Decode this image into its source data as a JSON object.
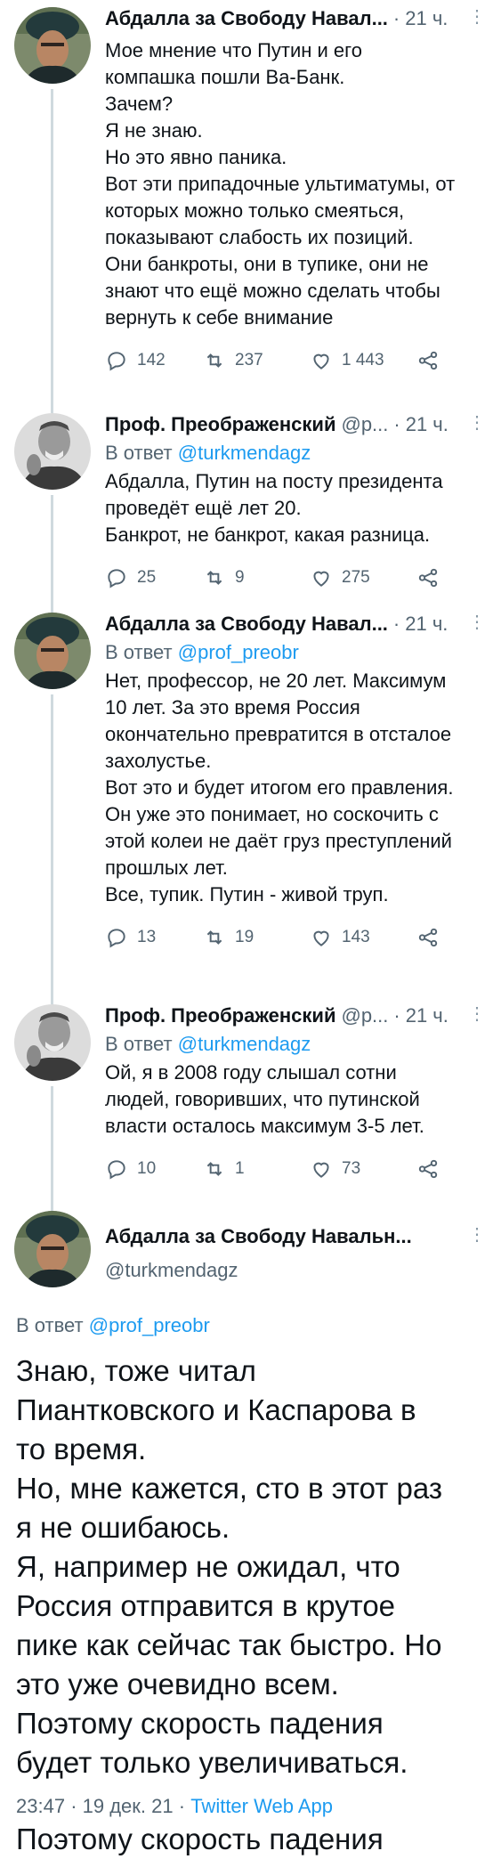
{
  "tweets": [
    {
      "name": "Абдалла за Свободу Навал...",
      "handle": "",
      "time": "21 ч.",
      "reply_to_prefix": "",
      "reply_to_handle": "",
      "lines": [
        "Мое мнение что Путин и его",
        "компашка пошли Ва-Банк.",
        "Зачем?",
        "Я не знаю.",
        "Но это явно паника.",
        "Вот эти припадочные ультиматумы, от",
        "которых можно только смеяться,",
        "показывают слабость их позиций.",
        "Они банкроты, они в тупике, они не",
        "знают что ещё можно сделать чтобы",
        "вернуть к себе внимание"
      ],
      "replies": "142",
      "retweets": "237",
      "likes": "1 443",
      "avatar": "turban-avatar"
    },
    {
      "name": "Проф. Преображенский",
      "handle": "@p...",
      "time": "21 ч.",
      "reply_to_prefix": "В ответ",
      "reply_to_handle": "@turkmendagz",
      "lines": [
        "Абдалла, Путин на посту президента",
        "проведёт ещё лет 20.",
        "Банкрот, не банкрот, какая разница."
      ],
      "replies": "25",
      "retweets": "9",
      "likes": "275",
      "avatar": "professor-avatar"
    },
    {
      "name": "Абдалла за Свободу Навал...",
      "handle": "",
      "time": "21 ч.",
      "reply_to_prefix": "В ответ",
      "reply_to_handle": "@prof_preobr",
      "lines": [
        "Нет, профессор, не 20 лет. Максимум",
        "10 лет. За это время Россия",
        "окончательно превратится в отсталое",
        "захолустье.",
        "Вот это и будет итогом его правления.",
        "Он уже это понимает, но соскочить с",
        "этой колеи не даёт груз преступлений",
        "прошлых лет.",
        "Все, тупик. Путин - живой труп."
      ],
      "replies": "13",
      "retweets": "19",
      "likes": "143",
      "avatar": "turban-avatar"
    },
    {
      "name": "Проф. Преображенский",
      "handle": "@p...",
      "time": "21 ч.",
      "reply_to_prefix": "В ответ",
      "reply_to_handle": "@turkmendagz",
      "lines": [
        "Ой, я в 2008 году слышал сотни",
        "людей, говоривших, что путинской",
        "власти осталось максимум 3-5 лет."
      ],
      "replies": "10",
      "retweets": "1",
      "likes": "73",
      "avatar": "professor-avatar"
    }
  ],
  "main_tweet": {
    "name": "Абдалла за Свободу Навальн...",
    "handle": "@turkmendagz",
    "reply_to_prefix": "В ответ",
    "reply_to_handle": "@prof_preobr",
    "lines": [
      "Знаю, тоже читал",
      "Пиантковского и Каспарова в",
      "то время.",
      "Но, мне кажется, сто в этот раз",
      "я не ошибаюсь.",
      "Я, например не ожидал, что",
      "Россия отправится в крутое",
      "пике как сейчас так быстро. Но",
      "это уже очевидно всем.",
      "Поэтому скорость падения",
      "будет только увеличиваться."
    ],
    "time": "23:47",
    "sep": "·",
    "date": "19 дек. 21",
    "app": "Twitter Web App",
    "overflow_line": "Поэтому скорость падения"
  },
  "ui": {
    "dot": "·",
    "more": "⋮"
  },
  "colors": {
    "accent": "#1d9bf0",
    "secondary_text": "#536471",
    "thread_line": "#cfd9de"
  }
}
